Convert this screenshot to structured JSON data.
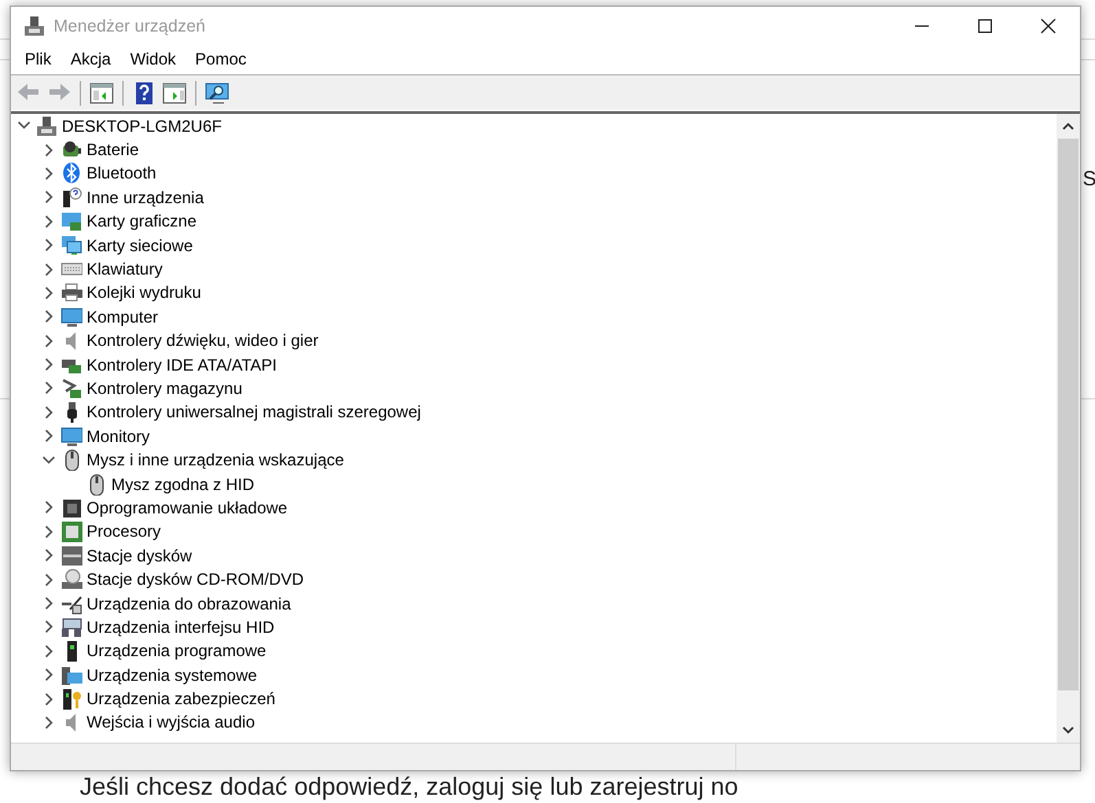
{
  "window": {
    "title": "Menedżer urządzeń",
    "active": false
  },
  "menu": [
    "Plik",
    "Akcja",
    "Widok",
    "Pomoc"
  ],
  "toolbar": [
    {
      "kind": "back",
      "disabled": true
    },
    {
      "kind": "forward",
      "disabled": true
    },
    {
      "kind": "sep"
    },
    {
      "kind": "console-tree",
      "disabled": false
    },
    {
      "kind": "sep"
    },
    {
      "kind": "help",
      "disabled": false
    },
    {
      "kind": "properties",
      "disabled": false
    },
    {
      "kind": "sep"
    },
    {
      "kind": "scan",
      "disabled": false
    }
  ],
  "tree": [
    {
      "label": "DESKTOP-LGM2U6F",
      "expanded": true,
      "children": [
        {
          "label": "Baterie",
          "expanded": false
        },
        {
          "label": "Bluetooth",
          "expanded": false
        },
        {
          "label": "Inne urządzenia",
          "expanded": false
        },
        {
          "label": "Karty graficzne",
          "expanded": false
        },
        {
          "label": "Karty sieciowe",
          "expanded": false
        },
        {
          "label": "Klawiatury",
          "expanded": false
        },
        {
          "label": "Kolejki wydruku",
          "expanded": false
        },
        {
          "label": "Komputer",
          "expanded": false
        },
        {
          "label": "Kontrolery dźwięku, wideo i gier",
          "expanded": false
        },
        {
          "label": "Kontrolery IDE ATA/ATAPI",
          "expanded": false
        },
        {
          "label": "Kontrolery magazynu",
          "expanded": false
        },
        {
          "label": "Kontrolery uniwersalnej magistrali szeregowej",
          "expanded": false
        },
        {
          "label": "Monitory",
          "expanded": false
        },
        {
          "label": "Mysz i inne urządzenia wskazujące",
          "expanded": true,
          "children": [
            {
              "label": "Mysz zgodna z HID"
            }
          ]
        },
        {
          "label": "Oprogramowanie układowe",
          "expanded": false
        },
        {
          "label": "Procesory",
          "expanded": false
        },
        {
          "label": "Stacje dysków",
          "expanded": false
        },
        {
          "label": "Stacje dysków CD-ROM/DVD",
          "expanded": false
        },
        {
          "label": "Urządzenia do obrazowania",
          "expanded": false
        },
        {
          "label": "Urządzenia interfejsu HID",
          "expanded": false
        },
        {
          "label": "Urządzenia programowe",
          "expanded": false
        },
        {
          "label": "Urządzenia systemowe",
          "expanded": false
        },
        {
          "label": "Urządzenia zabezpieczeń",
          "expanded": false
        },
        {
          "label": "Wejścia i wyjścia audio",
          "expanded": false
        }
      ]
    }
  ],
  "background": {
    "side_text": "S",
    "bottom_text": "Jeśli chcesz dodać odpowiedź, zaloguj się lub zarejestruj no"
  }
}
